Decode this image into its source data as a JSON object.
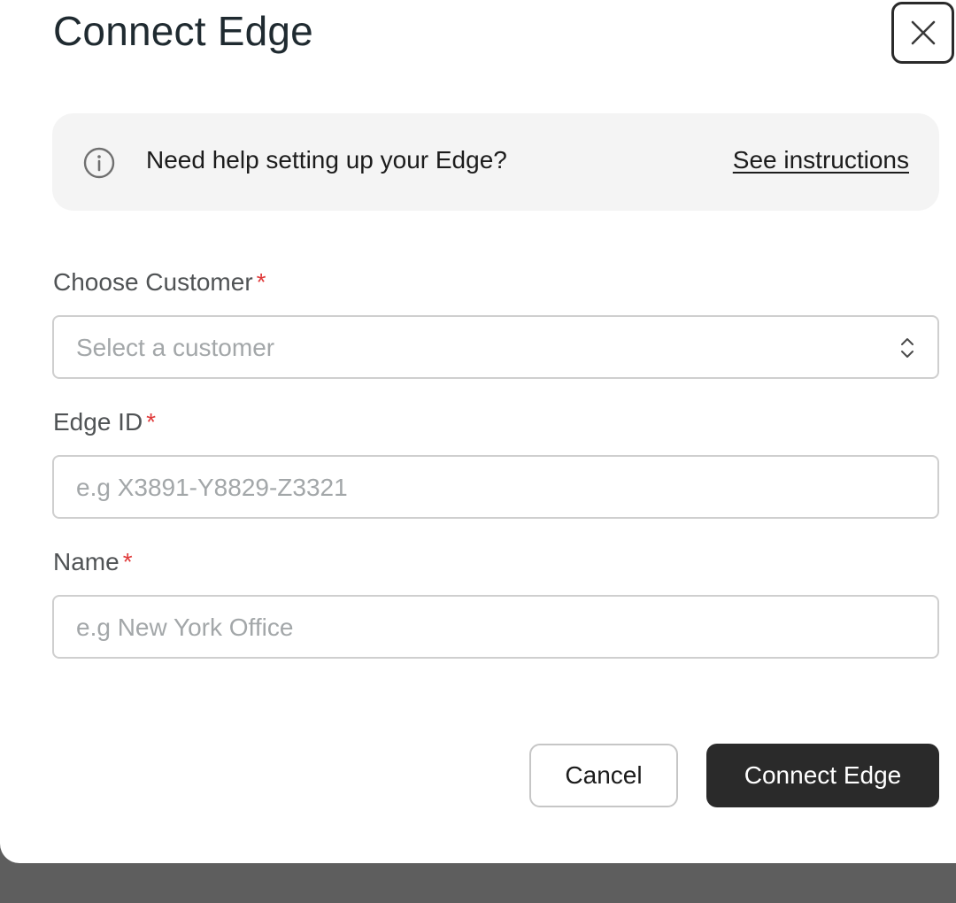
{
  "dialog": {
    "title": "Connect Edge"
  },
  "help": {
    "icon": "info-icon",
    "text": "Need help setting up your Edge?",
    "link_label": "See instructions"
  },
  "form": {
    "customer": {
      "label": "Choose Customer",
      "required_mark": "*",
      "placeholder": "Select a customer",
      "value": ""
    },
    "edge_id": {
      "label": "Edge ID",
      "required_mark": "*",
      "placeholder": "e.g X3891-Y8829-Z3321",
      "value": ""
    },
    "name": {
      "label": "Name",
      "required_mark": "*",
      "placeholder": "e.g New York Office",
      "value": ""
    }
  },
  "actions": {
    "cancel_label": "Cancel",
    "submit_label": "Connect Edge"
  },
  "colors": {
    "primary_button": "#2a2a2a",
    "required": "#e03a3a",
    "banner_bg": "#f4f4f4",
    "backdrop": "#5e5e5e"
  }
}
